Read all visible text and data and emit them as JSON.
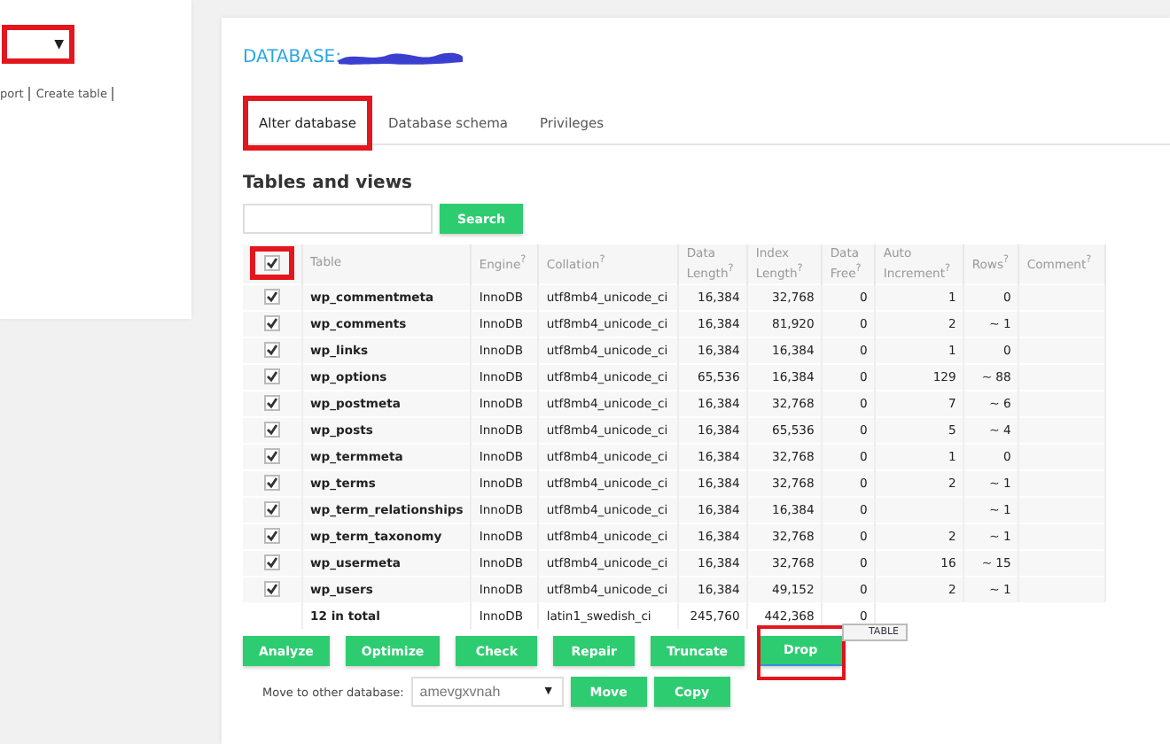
{
  "sidebar": {
    "select": {
      "highlighted": true,
      "caret": "▼"
    },
    "links": [
      "port",
      "Create table"
    ]
  },
  "title": {
    "text": "DATABASE:",
    "redacted": true
  },
  "tabs": [
    {
      "label": "Alter database",
      "selected": true,
      "highlighted": true
    },
    {
      "label": "Database schema",
      "selected": false,
      "highlighted": false
    },
    {
      "label": "Privileges",
      "selected": false,
      "highlighted": false
    }
  ],
  "heading": "Tables and views",
  "search": {
    "button": "Search"
  },
  "table": {
    "select_all": {
      "checked": true,
      "highlighted": true
    },
    "columns": [
      "Table",
      "Engine$^{?}$",
      "Collation$^{?}$",
      "Data Length$^{?}$",
      "Index Length$^{?}$",
      "Data Free$^{?}$",
      "Auto Increment$^{?}$",
      "Rows$^{?}$",
      "Comment$^{?}$"
    ],
    "rows": [
      {
        "checked": true,
        "cells": [
          "wp_commentmeta",
          "InnoDB",
          "utf8mb4_unicode_ci",
          "16,384",
          "32,768",
          "0",
          "1",
          "0",
          ""
        ]
      },
      {
        "checked": true,
        "cells": [
          "wp_comments",
          "InnoDB",
          "utf8mb4_unicode_ci",
          "16,384",
          "81,920",
          "0",
          "2",
          "~ 1",
          ""
        ]
      },
      {
        "checked": true,
        "cells": [
          "wp_links",
          "InnoDB",
          "utf8mb4_unicode_ci",
          "16,384",
          "16,384",
          "0",
          "1",
          "0",
          ""
        ]
      },
      {
        "checked": true,
        "cells": [
          "wp_options",
          "InnoDB",
          "utf8mb4_unicode_ci",
          "65,536",
          "16,384",
          "0",
          "129",
          "~ 88",
          ""
        ]
      },
      {
        "checked": true,
        "cells": [
          "wp_postmeta",
          "InnoDB",
          "utf8mb4_unicode_ci",
          "16,384",
          "32,768",
          "0",
          "7",
          "~ 6",
          ""
        ]
      },
      {
        "checked": true,
        "cells": [
          "wp_posts",
          "InnoDB",
          "utf8mb4_unicode_ci",
          "16,384",
          "65,536",
          "0",
          "5",
          "~ 4",
          ""
        ]
      },
      {
        "checked": true,
        "cells": [
          "wp_termmeta",
          "InnoDB",
          "utf8mb4_unicode_ci",
          "16,384",
          "32,768",
          "0",
          "1",
          "0",
          ""
        ]
      },
      {
        "checked": true,
        "cells": [
          "wp_terms",
          "InnoDB",
          "utf8mb4_unicode_ci",
          "16,384",
          "32,768",
          "0",
          "2",
          "~ 1",
          ""
        ]
      },
      {
        "checked": true,
        "cells": [
          "wp_term_relationships",
          "InnoDB",
          "utf8mb4_unicode_ci",
          "16,384",
          "16,384",
          "0",
          "",
          "~ 1",
          ""
        ]
      },
      {
        "checked": true,
        "cells": [
          "wp_term_taxonomy",
          "InnoDB",
          "utf8mb4_unicode_ci",
          "16,384",
          "32,768",
          "0",
          "2",
          "~ 1",
          ""
        ]
      },
      {
        "checked": true,
        "cells": [
          "wp_usermeta",
          "InnoDB",
          "utf8mb4_unicode_ci",
          "16,384",
          "32,768",
          "0",
          "16",
          "~ 15",
          ""
        ]
      },
      {
        "checked": true,
        "cells": [
          "wp_users",
          "InnoDB",
          "utf8mb4_unicode_ci",
          "16,384",
          "49,152",
          "0",
          "2",
          "~ 1",
          ""
        ]
      }
    ],
    "total": [
      "12 in total",
      "InnoDB",
      "latin1_swedish_ci",
      "245,760",
      "442,368",
      "0"
    ]
  },
  "actions": [
    {
      "label": "Analyze",
      "highlighted": false,
      "focused": false
    },
    {
      "label": "Optimize",
      "highlighted": false,
      "focused": false
    },
    {
      "label": "Check",
      "highlighted": false,
      "focused": false
    },
    {
      "label": "Repair",
      "highlighted": false,
      "focused": false
    },
    {
      "label": "Truncate",
      "highlighted": false,
      "focused": false
    },
    {
      "label": "Drop",
      "highlighted": true,
      "focused": true
    }
  ],
  "tooltip": "TABLE",
  "move": {
    "label": "Move to other database:",
    "value": "amevgxvnah",
    "caret": "▼",
    "buttons": [
      "Move",
      "Copy"
    ]
  }
}
